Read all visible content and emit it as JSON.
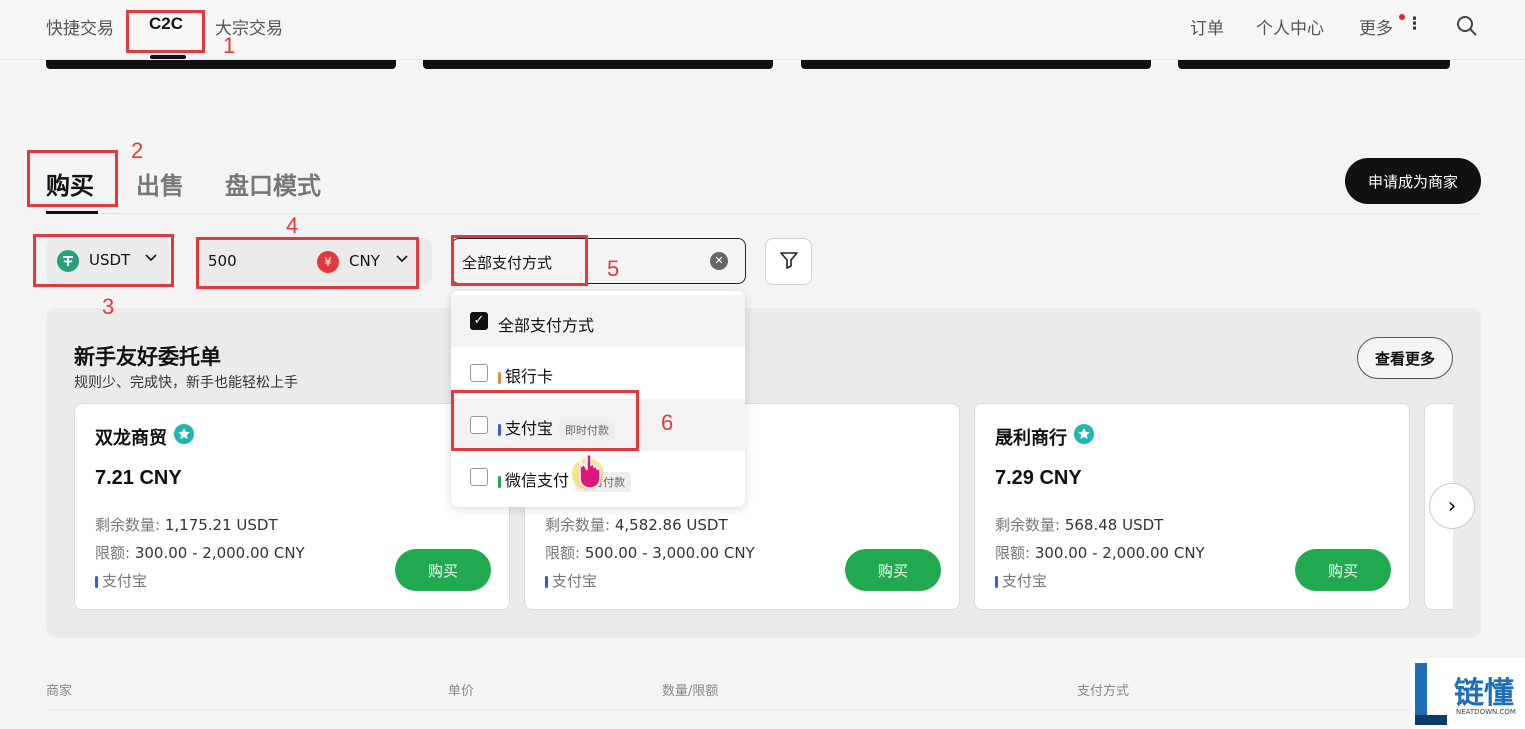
{
  "header": {
    "nav": [
      "快捷交易",
      "C2C",
      "大宗交易"
    ],
    "right": [
      "订单",
      "个人中心",
      "更多"
    ]
  },
  "annotations": [
    "1",
    "2",
    "3",
    "4",
    "5",
    "6"
  ],
  "tabs": [
    "购买",
    "出售",
    "盘口模式"
  ],
  "merchant_button": "申请成为商家",
  "filters": {
    "coin": "USDT",
    "amount": "500",
    "currency_symbol": "¥",
    "currency": "CNY",
    "payment": "全部支付方式"
  },
  "dropdown": {
    "items": [
      {
        "label": "全部支付方式",
        "checked": true,
        "tag": "",
        "color": ""
      },
      {
        "label": "银行卡",
        "checked": false,
        "tag": "",
        "color": "#e08a4a"
      },
      {
        "label": "支付宝",
        "checked": false,
        "tag": "即时付款",
        "color": "#3b5bd6"
      },
      {
        "label": "微信支付",
        "checked": false,
        "tag": "即时付款",
        "color": "#20a94f"
      }
    ]
  },
  "panel": {
    "title": "新手友好委托单",
    "subtitle": "规则少、完成快，新手也能轻松上手",
    "more": "查看更多",
    "cards": [
      {
        "name": "双龙商贸",
        "price": "7.21 CNY",
        "remaining_label": "剩余数量:",
        "remaining": "1,175.21 USDT",
        "limit_label": "限额:",
        "limit": "300.00 - 2,000.00 CNY",
        "payment": "支付宝",
        "buy": "购买"
      },
      {
        "name": "",
        "price": "",
        "remaining_label": "剩余数量:",
        "remaining": "4,582.86 USDT",
        "limit_label": "限额:",
        "limit": "500.00 - 3,000.00 CNY",
        "payment": "支付宝",
        "buy": "购买"
      },
      {
        "name": "晟利商行",
        "price": "7.29 CNY",
        "remaining_label": "剩余数量:",
        "remaining": "568.48 USDT",
        "limit_label": "限额:",
        "limit": "300.00 - 2,000.00 CNY",
        "payment": "支付宝",
        "buy": "购买"
      }
    ]
  },
  "table_headers": [
    "商家",
    "单价",
    "数量/限额",
    "支付方式"
  ],
  "watermark": {
    "text": "链懂",
    "sub": "NEATDOWN.COM"
  },
  "colors": {
    "accent_green": "#20a94f",
    "annotation_red": "#e23a3a",
    "alipay_blue": "#3b5bd6"
  }
}
